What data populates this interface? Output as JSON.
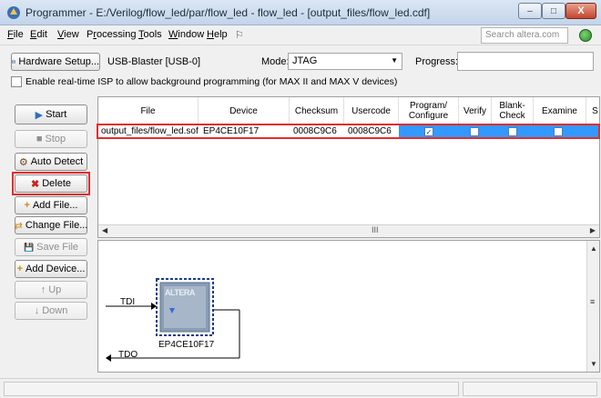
{
  "window": {
    "title": "Programmer - E:/Verilog/flow_led/par/flow_led - flow_led - [output_files/flow_led.cdf]",
    "controls": {
      "minimize": "–",
      "maximize": "□",
      "close": "X"
    }
  },
  "menu": {
    "items": [
      {
        "hot": "F",
        "rest": "ile"
      },
      {
        "hot": "E",
        "rest": "dit"
      },
      {
        "hot": "V",
        "rest": "iew"
      },
      {
        "pre": "P",
        "hot": "r",
        "rest": "ocessing"
      },
      {
        "hot": "T",
        "rest": "ools"
      },
      {
        "hot": "W",
        "rest": "indow"
      },
      {
        "hot": "H",
        "rest": "elp"
      }
    ],
    "extra_icon": "⚐",
    "search_placeholder": "Search altera.com"
  },
  "toolbar": {
    "hardware_setup_label": "Hardware Setup...",
    "hardware_value": "USB-Blaster [USB-0]",
    "mode_label": "Mode:",
    "mode_value": "JTAG",
    "progress_label": "Progress:",
    "progress_value": "",
    "isp_label": "Enable real-time ISP to allow background programming (for MAX II and MAX V devices)"
  },
  "left_buttons": [
    {
      "label": "Start",
      "icon": "▶",
      "enabled": true
    },
    {
      "label": "Stop",
      "icon": "■",
      "enabled": false
    },
    {
      "label": "Auto Detect",
      "icon": "⚙",
      "enabled": true
    },
    {
      "label": "Delete",
      "icon": "✖",
      "enabled": true
    },
    {
      "label": "Add File...",
      "icon": "+",
      "enabled": true
    },
    {
      "label": "Change File...",
      "icon": "⇄",
      "enabled": true
    },
    {
      "label": "Save File",
      "icon": "💾",
      "enabled": false
    },
    {
      "label": "Add Device...",
      "icon": "+",
      "enabled": true
    },
    {
      "label": "Up",
      "icon": "↑",
      "enabled": false
    },
    {
      "label": "Down",
      "icon": "↓",
      "enabled": false
    }
  ],
  "table": {
    "columns": [
      "File",
      "Device",
      "Checksum",
      "Usercode",
      "Program/ Configure",
      "Verify",
      "Blank- Check",
      "Examine",
      "S"
    ],
    "rows": [
      {
        "file": "output_files/flow_led.sof",
        "device": "EP4CE10F17",
        "checksum": "0008C9C6",
        "usercode": "0008C9C6",
        "program_configure": true,
        "verify": false,
        "blank_check": false,
        "examine": false
      }
    ],
    "hscroll_grip": "III"
  },
  "diagram": {
    "tdi_label": "TDI",
    "tdo_label": "TDO",
    "chip_logo": "ALTERA",
    "chip_label": "EP4CE10F17"
  },
  "colors": {
    "highlight": "#3399ff",
    "annotation_red": "#e22d2d",
    "delete_icon": "#d0201c"
  }
}
